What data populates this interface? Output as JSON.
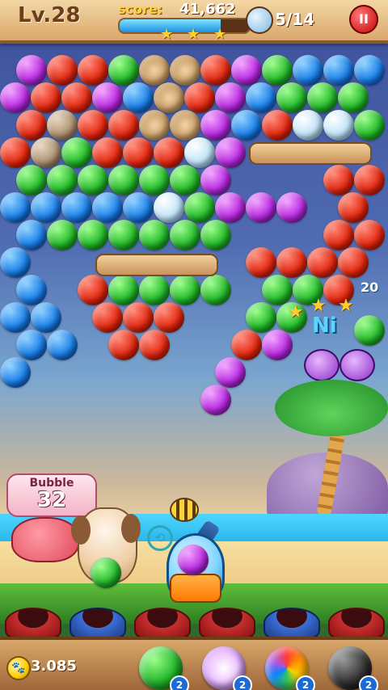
{
  "hud": {
    "level": "Lv.28",
    "score_label": "score:",
    "score_value": "41,662",
    "progress": 0.78,
    "stars_earned": 3,
    "birds_rescued": "5/14",
    "pause_label": "II"
  },
  "bubble_grid": {
    "colors": {
      "red": "#e22810",
      "green": "#23b82a",
      "blue": "#1a7fe8",
      "purple": "#b829e0"
    }
  },
  "effects": {
    "combo_text": "Ni",
    "points_text": "20"
  },
  "sign": {
    "title": "Bubble",
    "remaining": "32"
  },
  "shooter": {
    "loaded_bubble": "purple",
    "next_bubble": "green",
    "swap_icon": "swap-arrows"
  },
  "bottom_bar": {
    "coins": "3.085",
    "boosters": [
      {
        "name": "aim-line",
        "count": "2"
      },
      {
        "name": "lightning",
        "count": "2"
      },
      {
        "name": "rainbow",
        "count": "2"
      },
      {
        "name": "bomb",
        "count": "2"
      }
    ]
  }
}
